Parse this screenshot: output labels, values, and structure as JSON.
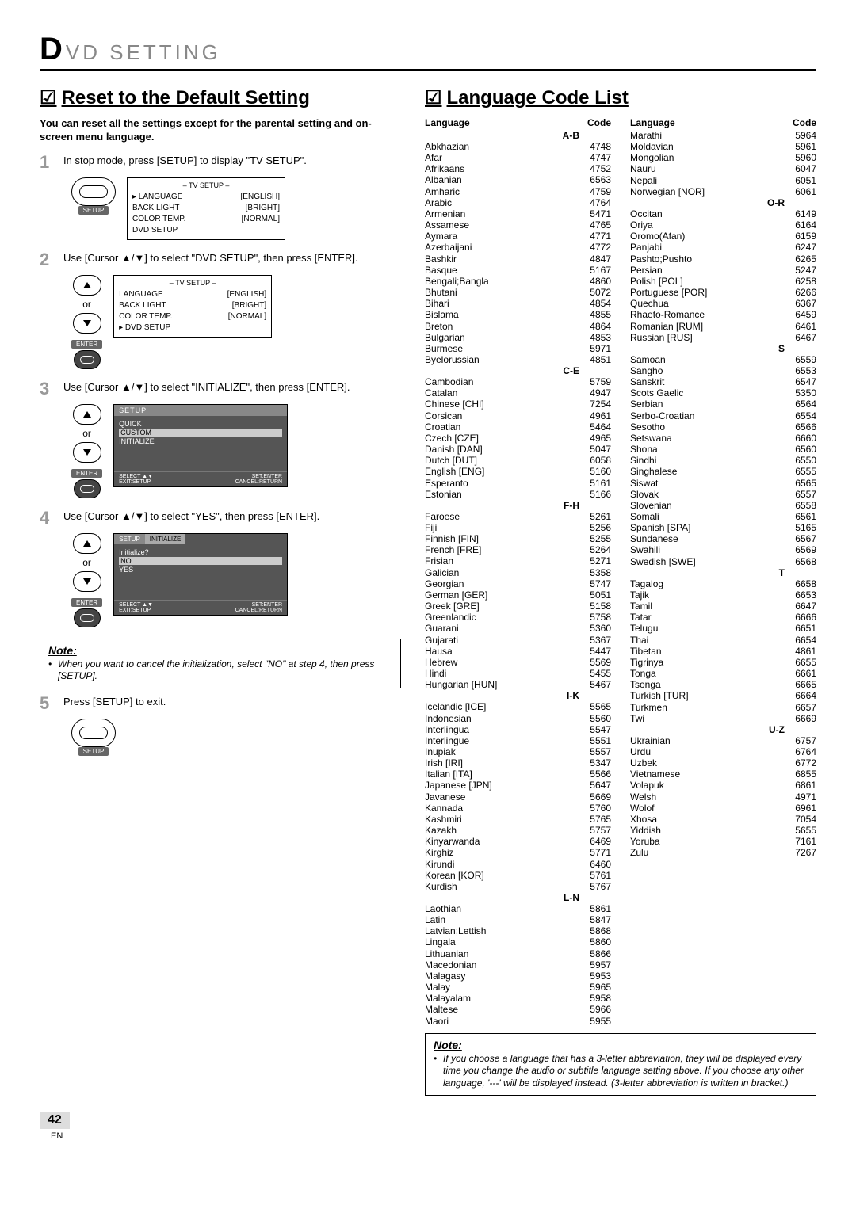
{
  "header": {
    "prefix": "D",
    "rest": "VD   SETTING"
  },
  "reset": {
    "title": "Reset to the Default Setting",
    "intro": "You can reset all the settings except for the parental setting and on-screen menu language.",
    "step1": "In stop mode, press [SETUP] to display \"TV SETUP\".",
    "step2": "Use [Cursor ▲/▼] to select \"DVD SETUP\", then press [ENTER].",
    "step3": "Use [Cursor ▲/▼] to select \"INITIALIZE\", then press [ENTER].",
    "step4": "Use [Cursor ▲/▼] to select \"YES\", then press [ENTER].",
    "step5": "Press [SETUP] to exit.",
    "note_title": "Note:",
    "note_body": "When you want to cancel the initialization, select \"NO\" at step 4, then press [SETUP]."
  },
  "osd1": {
    "title": "–  TV SETUP  –",
    "rows": [
      {
        "arrow": "▸",
        "label": "LANGUAGE",
        "val": "[ENGLISH]"
      },
      {
        "arrow": "",
        "label": "BACK LIGHT",
        "val": "[BRIGHT]"
      },
      {
        "arrow": "",
        "label": "COLOR TEMP.",
        "val": "[NORMAL]"
      },
      {
        "arrow": "",
        "label": "DVD SETUP",
        "val": ""
      }
    ]
  },
  "osd2": {
    "title": "–  TV SETUP  –",
    "rows": [
      {
        "arrow": "",
        "label": "LANGUAGE",
        "val": "[ENGLISH]"
      },
      {
        "arrow": "",
        "label": "BACK LIGHT",
        "val": "[BRIGHT]"
      },
      {
        "arrow": "",
        "label": "COLOR TEMP.",
        "val": "[NORMAL]"
      },
      {
        "arrow": "▸",
        "label": "DVD SETUP",
        "val": ""
      }
    ]
  },
  "osd3": {
    "hdr": "SETUP",
    "items": [
      "QUICK",
      "CUSTOM",
      "INITIALIZE"
    ],
    "selected_index": 1,
    "footer_l": "SELECT ▲▼",
    "footer_l2": "EXIT:SETUP",
    "footer_r": "SET:ENTER",
    "footer_r2": "CANCEL:RETURN"
  },
  "osd4": {
    "hdr1": "SETUP",
    "hdr2": "INITIALIZE",
    "prompt": "Initialize?",
    "items": [
      "NO",
      "YES"
    ],
    "selected_index": 0,
    "footer_l": "SELECT ▲▼",
    "footer_l2": "EXIT:SETUP",
    "footer_r": "SET:ENTER",
    "footer_r2": "CANCEL:RETURN"
  },
  "labels": {
    "or": "or",
    "setup": "SETUP",
    "enter": "ENTER"
  },
  "lang": {
    "title": "Language Code List",
    "head_lang": "Language",
    "head_code": "Code",
    "note_title": "Note:",
    "note_body": "If you choose a language that has a 3-letter abbreviation, they will be displayed every time you change the audio or subtitle language setting above. If you choose any other language, '---' will be displayed instead. (3-letter abbreviation is written in bracket.)",
    "groups_left": [
      {
        "label": "A-B",
        "items": [
          [
            "Abkhazian",
            "4748"
          ],
          [
            "Afar",
            "4747"
          ],
          [
            "Afrikaans",
            "4752"
          ],
          [
            "Albanian",
            "6563"
          ],
          [
            "Amharic",
            "4759"
          ],
          [
            "Arabic",
            "4764"
          ],
          [
            "Armenian",
            "5471"
          ],
          [
            "Assamese",
            "4765"
          ],
          [
            "Aymara",
            "4771"
          ],
          [
            "Azerbaijani",
            "4772"
          ],
          [
            "Bashkir",
            "4847"
          ],
          [
            "Basque",
            "5167"
          ],
          [
            "Bengali;Bangla",
            "4860"
          ],
          [
            "Bhutani",
            "5072"
          ],
          [
            "Bihari",
            "4854"
          ],
          [
            "Bislama",
            "4855"
          ],
          [
            "Breton",
            "4864"
          ],
          [
            "Bulgarian",
            "4853"
          ],
          [
            "Burmese",
            "5971"
          ],
          [
            "Byelorussian",
            "4851"
          ]
        ]
      },
      {
        "label": "C-E",
        "items": [
          [
            "Cambodian",
            "5759"
          ],
          [
            "Catalan",
            "4947"
          ],
          [
            "Chinese [CHI]",
            "7254"
          ],
          [
            "Corsican",
            "4961"
          ],
          [
            "Croatian",
            "5464"
          ],
          [
            "Czech [CZE]",
            "4965"
          ],
          [
            "Danish [DAN]",
            "5047"
          ],
          [
            "Dutch [DUT]",
            "6058"
          ],
          [
            "English [ENG]",
            "5160"
          ],
          [
            "Esperanto",
            "5161"
          ],
          [
            "Estonian",
            "5166"
          ]
        ]
      },
      {
        "label": "F-H",
        "items": [
          [
            "Faroese",
            "5261"
          ],
          [
            "Fiji",
            "5256"
          ],
          [
            "Finnish [FIN]",
            "5255"
          ],
          [
            "French [FRE]",
            "5264"
          ],
          [
            "Frisian",
            "5271"
          ],
          [
            "Galician",
            "5358"
          ],
          [
            "Georgian",
            "5747"
          ],
          [
            "German [GER]",
            "5051"
          ],
          [
            "Greek [GRE]",
            "5158"
          ],
          [
            "Greenlandic",
            "5758"
          ],
          [
            "Guarani",
            "5360"
          ],
          [
            "Gujarati",
            "5367"
          ],
          [
            "Hausa",
            "5447"
          ],
          [
            "Hebrew",
            "5569"
          ],
          [
            "Hindi",
            "5455"
          ],
          [
            "Hungarian [HUN]",
            "5467"
          ]
        ]
      },
      {
        "label": "I-K",
        "items": [
          [
            "Icelandic [ICE]",
            "5565"
          ],
          [
            "Indonesian",
            "5560"
          ],
          [
            "Interlingua",
            "5547"
          ],
          [
            "Interlingue",
            "5551"
          ],
          [
            "Inupiak",
            "5557"
          ],
          [
            "Irish [IRI]",
            "5347"
          ],
          [
            "Italian [ITA]",
            "5566"
          ],
          [
            "Japanese [JPN]",
            "5647"
          ],
          [
            "Javanese",
            "5669"
          ],
          [
            "Kannada",
            "5760"
          ],
          [
            "Kashmiri",
            "5765"
          ],
          [
            "Kazakh",
            "5757"
          ],
          [
            "Kinyarwanda",
            "6469"
          ],
          [
            "Kirghiz",
            "5771"
          ],
          [
            "Kirundi",
            "6460"
          ],
          [
            "Korean [KOR]",
            "5761"
          ],
          [
            "Kurdish",
            "5767"
          ]
        ]
      },
      {
        "label": "L-N",
        "items": [
          [
            "Laothian",
            "5861"
          ],
          [
            "Latin",
            "5847"
          ],
          [
            "Latvian;Lettish",
            "5868"
          ],
          [
            "Lingala",
            "5860"
          ],
          [
            "Lithuanian",
            "5866"
          ],
          [
            "Macedonian",
            "5957"
          ],
          [
            "Malagasy",
            "5953"
          ],
          [
            "Malay",
            "5965"
          ],
          [
            "Malayalam",
            "5958"
          ],
          [
            "Maltese",
            "5966"
          ],
          [
            "Maori",
            "5955"
          ]
        ]
      }
    ],
    "groups_right": [
      {
        "label": "",
        "items": [
          [
            "Marathi",
            "5964"
          ],
          [
            "Moldavian",
            "5961"
          ],
          [
            "Mongolian",
            "5960"
          ],
          [
            "Nauru",
            "6047"
          ],
          [
            "Nepali",
            "6051"
          ],
          [
            "Norwegian [NOR]",
            "6061"
          ]
        ]
      },
      {
        "label": "O-R",
        "items": [
          [
            "Occitan",
            "6149"
          ],
          [
            "Oriya",
            "6164"
          ],
          [
            "Oromo(Afan)",
            "6159"
          ],
          [
            "Panjabi",
            "6247"
          ],
          [
            "Pashto;Pushto",
            "6265"
          ],
          [
            "Persian",
            "5247"
          ],
          [
            "Polish [POL]",
            "6258"
          ],
          [
            "Portuguese [POR]",
            "6266"
          ],
          [
            "Quechua",
            "6367"
          ],
          [
            "Rhaeto-Romance",
            "6459"
          ],
          [
            "Romanian [RUM]",
            "6461"
          ],
          [
            "Russian [RUS]",
            "6467"
          ]
        ]
      },
      {
        "label": "S",
        "items": [
          [
            "Samoan",
            "6559"
          ],
          [
            "Sangho",
            "6553"
          ],
          [
            "Sanskrit",
            "6547"
          ],
          [
            "Scots Gaelic",
            "5350"
          ],
          [
            "Serbian",
            "6564"
          ],
          [
            "Serbo-Croatian",
            "6554"
          ],
          [
            "Sesotho",
            "6566"
          ],
          [
            "Setswana",
            "6660"
          ],
          [
            "Shona",
            "6560"
          ],
          [
            "Sindhi",
            "6550"
          ],
          [
            "Singhalese",
            "6555"
          ],
          [
            "Siswat",
            "6565"
          ],
          [
            "Slovak",
            "6557"
          ],
          [
            "Slovenian",
            "6558"
          ],
          [
            "Somali",
            "6561"
          ],
          [
            "Spanish [SPA]",
            "5165"
          ],
          [
            "Sundanese",
            "6567"
          ],
          [
            "Swahili",
            "6569"
          ],
          [
            "Swedish [SWE]",
            "6568"
          ]
        ]
      },
      {
        "label": "T",
        "items": [
          [
            "Tagalog",
            "6658"
          ],
          [
            "Tajik",
            "6653"
          ],
          [
            "Tamil",
            "6647"
          ],
          [
            "Tatar",
            "6666"
          ],
          [
            "Telugu",
            "6651"
          ],
          [
            "Thai",
            "6654"
          ],
          [
            "Tibetan",
            "4861"
          ],
          [
            "Tigrinya",
            "6655"
          ],
          [
            "Tonga",
            "6661"
          ],
          [
            "Tsonga",
            "6665"
          ],
          [
            "Turkish [TUR]",
            "6664"
          ],
          [
            "Turkmen",
            "6657"
          ],
          [
            "Twi",
            "6669"
          ]
        ]
      },
      {
        "label": "U-Z",
        "items": [
          [
            "Ukrainian",
            "6757"
          ],
          [
            "Urdu",
            "6764"
          ],
          [
            "Uzbek",
            "6772"
          ],
          [
            "Vietnamese",
            "6855"
          ],
          [
            "Volapuk",
            "6861"
          ],
          [
            "Welsh",
            "4971"
          ],
          [
            "Wolof",
            "6961"
          ],
          [
            "Xhosa",
            "7054"
          ],
          [
            "Yiddish",
            "5655"
          ],
          [
            "Yoruba",
            "7161"
          ],
          [
            "Zulu",
            "7267"
          ]
        ]
      }
    ]
  },
  "page": {
    "num": "42",
    "en": "EN"
  }
}
